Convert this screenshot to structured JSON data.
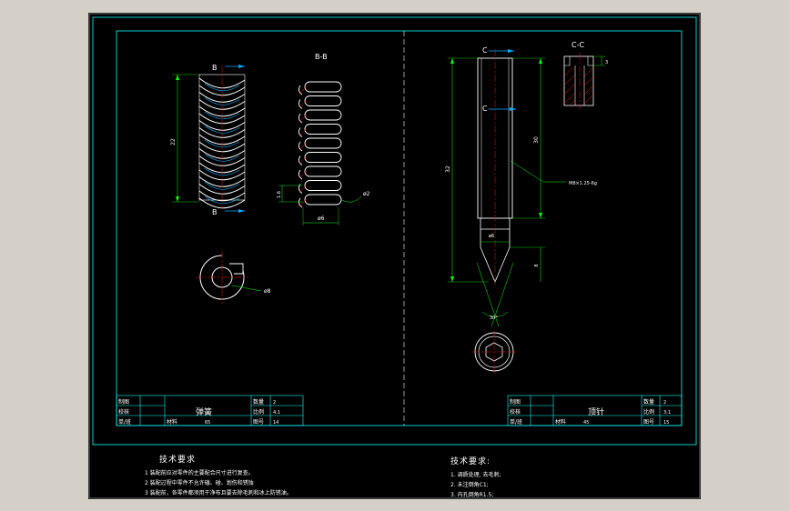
{
  "left_drawing": {
    "section_label": "B-B",
    "cut_mark_top": "B",
    "cut_mark_bottom": "B",
    "dim_height": "22",
    "dim_pitch": "1.6",
    "dim_diameter": "ø6",
    "dim_wire": "ø2",
    "dim_ring": "ø8",
    "title_block": {
      "drawn_label": "制图",
      "checked_label": "校核",
      "unit_label": "单/班",
      "part_name": "弹簧",
      "qty_label": "数量",
      "qty_value": "2",
      "scale_label": "比例",
      "scale_value": "4:1",
      "material_label": "材料",
      "material_value": "65",
      "drawing_no_label": "图号",
      "drawing_no_value": "14"
    }
  },
  "right_drawing": {
    "section_label": "C-C",
    "cut_mark_top": "C",
    "cut_mark_mid": "C",
    "dim_total": "32",
    "dim_thread_len": "30",
    "dim_thread": "M8×1.25-6g",
    "dim_tip_dia": "ø6",
    "dim_tip_len": "8",
    "dim_angle": "30°",
    "dim_hex": "3",
    "title_block": {
      "drawn_label": "制图",
      "checked_label": "校核",
      "unit_label": "单/班",
      "part_name": "顶针",
      "qty_label": "数量",
      "qty_value": "2",
      "scale_label": "比例",
      "scale_value": "3:1",
      "material_label": "材料",
      "material_value": "45",
      "drawing_no_label": "图号",
      "drawing_no_value": "15"
    }
  },
  "notes_left": {
    "title": "技术要求",
    "lines": [
      "1  装配前应对零件的主要配合尺寸进行复查。",
      "2  装配过程中零件不允许磕、碰、划伤和锈蚀",
      "3  装配前，各零件都须用干净布且要去除毛刺和冰上防锈油。"
    ]
  },
  "notes_right": {
    "title": "技术要求:",
    "lines": [
      "1. 调质处理, 去毛刺;",
      "2. 未注倒角C1;",
      "3. 内孔倒角R1.5;"
    ]
  },
  "colors": {
    "frame": "#00ffff",
    "line": "#ffffff",
    "center": "#ff0000",
    "dim": "#00ff00",
    "accent": "#00aaff"
  }
}
